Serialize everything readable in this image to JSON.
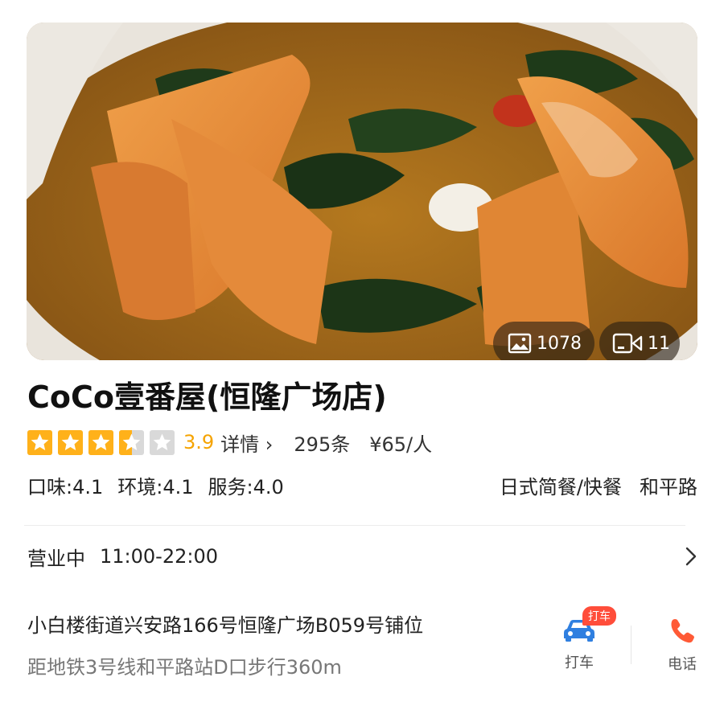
{
  "hero": {
    "photo_count": "1078",
    "video_count": "11",
    "photo_icon": "image-icon",
    "video_icon": "video-camera-icon"
  },
  "shop": {
    "name": "CoCo壹番屋(恒隆广场店)",
    "rating": "3.9",
    "rating_value": 3.5,
    "rating_max": 5,
    "details_label": "详情",
    "reviews": "295条",
    "price": "¥65/人",
    "subscores": [
      "口味:4.1",
      "环境:4.1",
      "服务:4.0"
    ],
    "category": "日式简餐/快餐",
    "district": "和平路"
  },
  "hours": {
    "status": "营业中",
    "time": "11:00-22:00"
  },
  "location": {
    "address": "小白楼街道兴安路166号恒隆广场B059号铺位",
    "distance": "距地铁3号线和平路站D口步行360m"
  },
  "actions": {
    "taxi_badge": "打车",
    "taxi_label": "打车",
    "phone_label": "电话"
  },
  "colors": {
    "star": "#ffb11a",
    "score": "#f5a300",
    "taxi_icon": "#2f7fe0",
    "phone_icon": "#ff5a36",
    "badge": "#ff4d3a"
  }
}
